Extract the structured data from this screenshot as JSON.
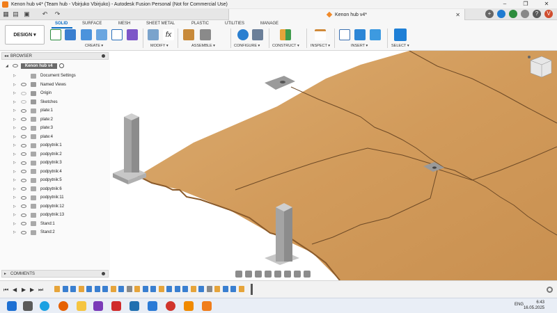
{
  "window": {
    "title": "Kenon hub v4* (Team hub - Vbirjuko Vbirjuko) - Autodesk Fusion Personal (Not for Commercial Use)",
    "controls": [
      "–",
      "❐",
      "✕"
    ]
  },
  "doc_tab": {
    "label": "Kenon hub v4*",
    "close": "✕"
  },
  "ribbon": {
    "workspace": "DESIGN ▾",
    "tabs": [
      "SOLID",
      "SURFACE",
      "MESH",
      "SHEET METAL",
      "PLASTIC",
      "UTILITIES",
      "MANAGE"
    ],
    "active_tab": "SOLID",
    "groups": [
      "CREATE ▾",
      "MODIFY ▾",
      "ASSEMBLE ▾",
      "CONFIGURE ▾",
      "CONSTRUCT ▾",
      "INSPECT ▾",
      "INSERT ▾",
      "SELECT ▾"
    ]
  },
  "browser": {
    "header": "BROWSER",
    "root": "Kenon hub v4",
    "items": [
      {
        "label": "Document Settings",
        "icon": "gear-icon"
      },
      {
        "label": "Named Views",
        "icon": "folder-icon"
      },
      {
        "label": "Origin",
        "icon": "folder-icon"
      },
      {
        "label": "Sketches",
        "icon": "folder-icon"
      },
      {
        "label": "plate:1",
        "icon": "body-icon"
      },
      {
        "label": "plate:2",
        "icon": "body-icon"
      },
      {
        "label": "plate:3",
        "icon": "body-icon"
      },
      {
        "label": "plate:4",
        "icon": "body-icon"
      },
      {
        "label": "podpytnik:1",
        "icon": "body-icon"
      },
      {
        "label": "podpytnik:2",
        "icon": "body-icon"
      },
      {
        "label": "podpytnik:3",
        "icon": "body-icon"
      },
      {
        "label": "podpytnik:4",
        "icon": "body-icon"
      },
      {
        "label": "podpytnik:5",
        "icon": "body-icon"
      },
      {
        "label": "podpytnik:6",
        "icon": "body-icon"
      },
      {
        "label": "podpytnik:11",
        "icon": "body-icon"
      },
      {
        "label": "podpytnik:12",
        "icon": "body-icon"
      },
      {
        "label": "podpytnik:13",
        "icon": "body-icon"
      },
      {
        "label": "Stand:1",
        "icon": "body-icon"
      },
      {
        "label": "Stand:2",
        "icon": "body-icon"
      }
    ]
  },
  "comments": {
    "header": "COMMENTS"
  },
  "taskbar": {
    "tray_lang": "ENG",
    "time": "6:43",
    "date": "16.05.2025"
  },
  "colors": {
    "accent": "#0a6cc4",
    "wood": "#d8a262",
    "wood_dark": "#c38a4b",
    "stand": "#a4a4a4"
  }
}
